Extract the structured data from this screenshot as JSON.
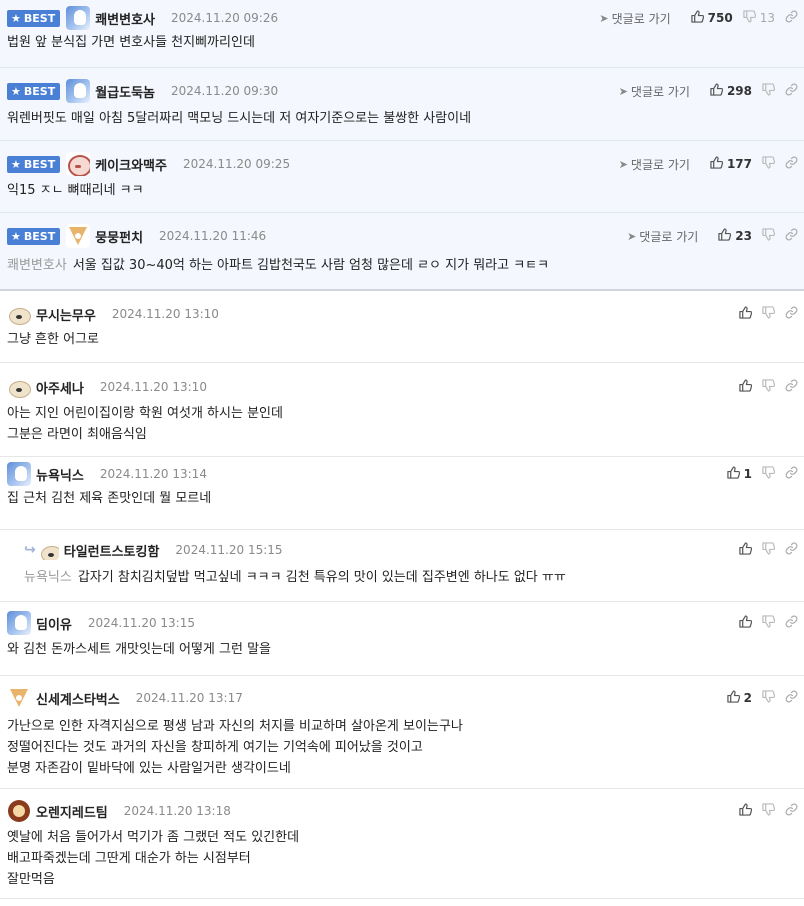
{
  "ui": {
    "best_label": "BEST",
    "goto_label": "댓글로 가기"
  },
  "comments": [
    {
      "nick": "쾌변변호사",
      "date": "2024.11.20 09:26",
      "likes": "750",
      "dislikes": "13",
      "avatar": "blue",
      "best": true,
      "lines": [
        "법원 앞 분식집 가면 변호사들 천지삐까리인데"
      ]
    },
    {
      "nick": "월급도둑놈",
      "date": "2024.11.20 09:30",
      "likes": "298",
      "dislikes": "",
      "avatar": "blue",
      "best": true,
      "lines": [
        "워렌버핏도 매일 아침 5달러짜리 맥모닝 드시는데 저 여자기준으로는 불쌍한 사람이네"
      ]
    },
    {
      "nick": "케이크와맥주",
      "date": "2024.11.20 09:25",
      "likes": "177",
      "dislikes": "",
      "avatar": "cake",
      "best": true,
      "lines": [
        "익15 ㅈㄴ 뼈때리네 ㅋㅋ"
      ]
    },
    {
      "nick": "뭉뭉펀치",
      "date": "2024.11.20 11:46",
      "likes": "23",
      "dislikes": "",
      "avatar": "fox",
      "best": true,
      "ref": "쾌변변호사",
      "lines": [
        "서울 집값 30~40억 하는 아파트 김밥천국도 사람 엄청 많은데 ㄹㅇ 지가 뭐라고 ㅋㅌㅋ"
      ]
    },
    {
      "nick": "무시는무우",
      "date": "2024.11.20 13:10",
      "likes": "",
      "dislikes": "",
      "avatar": "dog",
      "lines": [
        "그냥 흔한 어그로"
      ]
    },
    {
      "nick": "아주세나",
      "date": "2024.11.20 13:10",
      "likes": "",
      "dislikes": "",
      "avatar": "dog",
      "lines": [
        "아는 지인 어린이집이랑 학원 여섯개 하시는 분인데",
        "그분은 라면이 최애음식임"
      ]
    },
    {
      "nick": "뉴욕닉스",
      "date": "2024.11.20 13:14",
      "likes": "1",
      "dislikes": "",
      "avatar": "blue",
      "lines": [
        "집 근처 김천 제육 존맛인데 뭘 모르네"
      ]
    },
    {
      "nick": "타일런트스토킹함",
      "date": "2024.11.20 15:15",
      "likes": "",
      "dislikes": "",
      "avatar": "dog",
      "reply": true,
      "ref": "뉴욕닉스",
      "lines": [
        "갑자기 참치김치덮밥 먹고싶네 ㅋㅋㅋ 김천 특유의 맛이 있는데 집주변엔 하나도 없다 ㅠㅠ"
      ]
    },
    {
      "nick": "딤이유",
      "date": "2024.11.20 13:15",
      "likes": "",
      "dislikes": "",
      "avatar": "blue",
      "lines": [
        "와 김천 돈까스세트 개맛잇는데 어떻게 그런 말을"
      ]
    },
    {
      "nick": "신세계스타벅스",
      "date": "2024.11.20 13:17",
      "likes": "2",
      "dislikes": "",
      "avatar": "fox",
      "lines": [
        "가난으로 인한 자격지심으로 평생 남과 자신의 처지를 비교하며 살아온게 보이는구나",
        "정떨어진다는 것도 과거의 자신을 창피하게 여기는 기억속에 피어났을 것이고",
        "분명 자존감이 밑바닥에 있는 사람일거란 생각이드네"
      ]
    },
    {
      "nick": "오렌지레드팀",
      "date": "2024.11.20 13:18",
      "likes": "",
      "dislikes": "",
      "avatar": "lion",
      "lines": [
        "옛날에 처음 들어가서 먹기가 좀 그랬던 적도 있긴한데",
        "배고파죽겠는데 그딴게 대순가 하는 시점부터",
        "잘만먹음"
      ]
    }
  ]
}
